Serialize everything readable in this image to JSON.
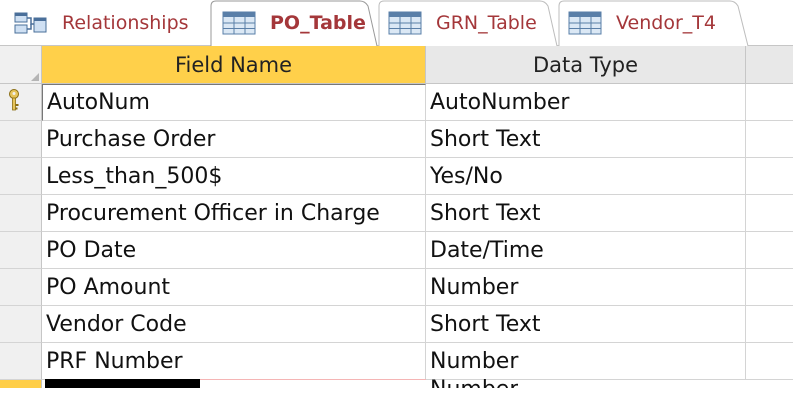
{
  "tabs": [
    {
      "label": "Relationships",
      "icon": "relationships-icon",
      "active": false
    },
    {
      "label": "PO_Table",
      "icon": "table-icon",
      "active": true
    },
    {
      "label": "GRN_Table",
      "icon": "table-icon",
      "active": false
    },
    {
      "label": "Vendor_T4",
      "icon": "table-icon",
      "active": false
    }
  ],
  "grid": {
    "headers": {
      "field_name": "Field Name",
      "data_type": "Data Type"
    },
    "primary_key_icon": "key-icon",
    "rows": [
      {
        "field": "AutoNum",
        "type": "AutoNumber"
      },
      {
        "field": "Purchase Order",
        "type": "Short Text"
      },
      {
        "field": "Less_than_500$",
        "type": "Yes/No"
      },
      {
        "field": "Procurement Officer in Charge",
        "type": "Short Text"
      },
      {
        "field": "PO Date",
        "type": "Date/Time"
      },
      {
        "field": "PO Amount",
        "type": "Number"
      },
      {
        "field": "Vendor Code",
        "type": "Short Text"
      },
      {
        "field": "PRF Number",
        "type": "Number"
      }
    ],
    "partial_row": {
      "type_partial": "Number"
    }
  },
  "colors": {
    "accent": "#ffd04a",
    "tab_text": "#a4373a",
    "selected_row": "#ffce47"
  }
}
